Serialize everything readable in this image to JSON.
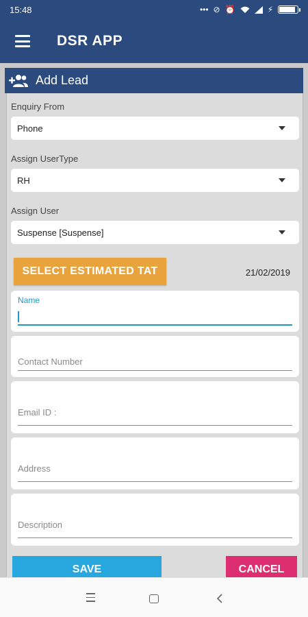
{
  "status_bar": {
    "time": "15:48",
    "icons": [
      "more-dots-icon",
      "sync-off-icon",
      "alarm-icon",
      "wifi-icon",
      "signal-icon",
      "charging-icon",
      "battery-icon"
    ],
    "battery_level": 0.9
  },
  "app_bar": {
    "title": "DSR APP",
    "menu_icon": "hamburger-menu-icon"
  },
  "section": {
    "title": "Add Lead",
    "icon": "add-user-icon"
  },
  "form": {
    "enquiry_from": {
      "label": "Enquiry From",
      "value": "Phone"
    },
    "assign_usertype": {
      "label": "Assign UserType",
      "value": "RH"
    },
    "assign_user": {
      "label": "Assign User",
      "value": "Suspense [Suspense]"
    },
    "tat_button": "SELECT ESTIMATED TAT",
    "tat_date": "21/02/2019",
    "name_label": "Name",
    "name_value": "",
    "contact_hint": "Contact Number",
    "email_hint": "Email ID :",
    "address_hint": "Address",
    "description_hint": "Description",
    "save_label": "SAVE",
    "cancel_label": "CANCEL"
  },
  "nav_bar": {
    "icons": [
      "recents-menu-icon",
      "home-icon",
      "back-icon"
    ]
  },
  "colors": {
    "primary": "#2b4a7d",
    "accent_orange": "#e9a33d",
    "save_blue": "#28a7df",
    "cancel_pink": "#de2e72",
    "focus_blue": "#2196c8"
  }
}
